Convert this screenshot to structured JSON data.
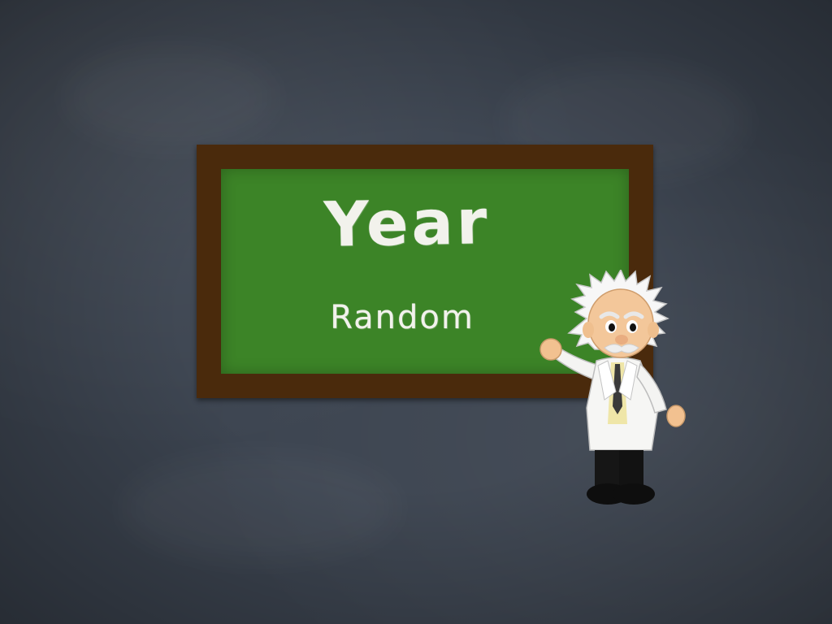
{
  "slide": {
    "background_color": "#3c4450",
    "chalkboard": {
      "frame_color": "#4a2a0c",
      "surface_color": "#3c8427",
      "title": "Year",
      "subtitle": "Random"
    },
    "character": {
      "icon": "professor-illustration-icon"
    }
  }
}
